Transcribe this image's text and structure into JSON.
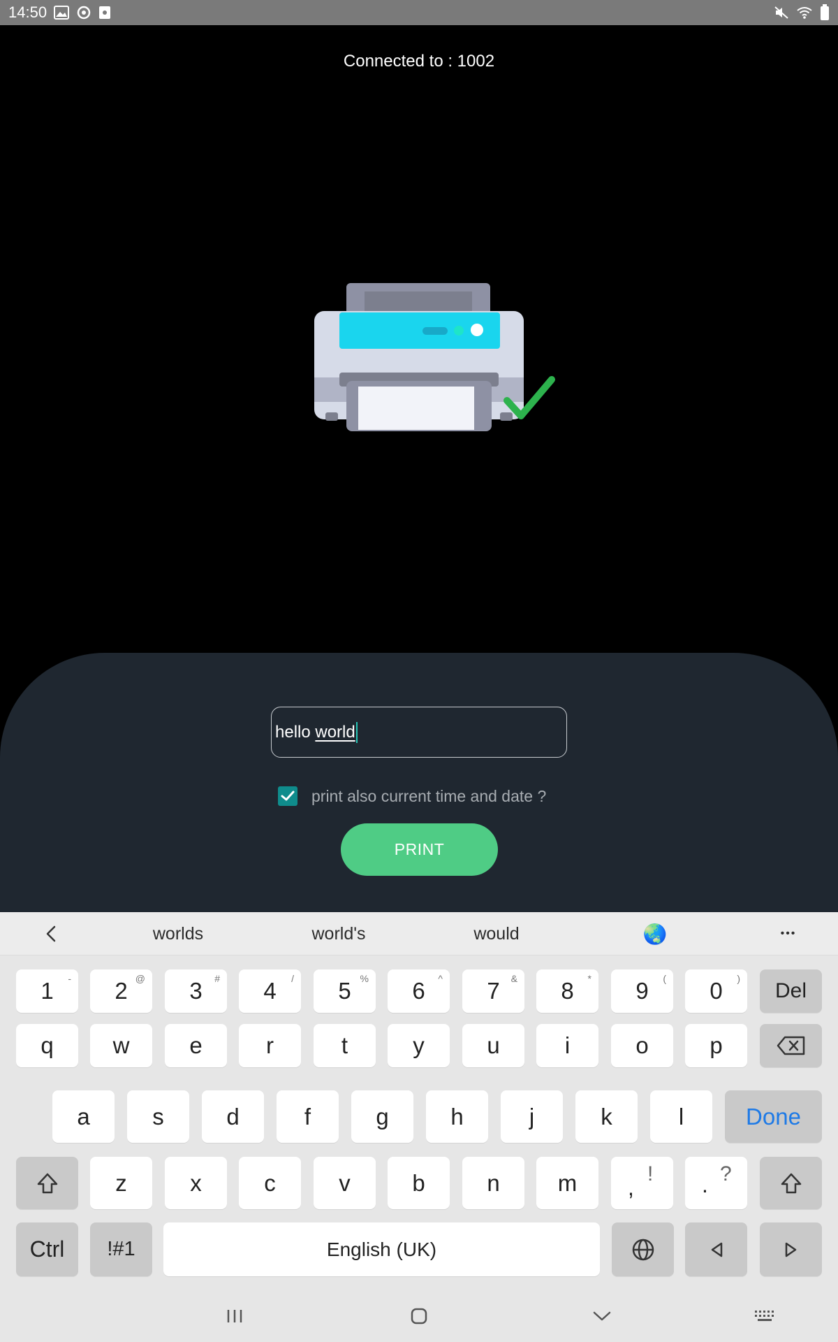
{
  "status_bar": {
    "time": "14:50",
    "left_icons": [
      "image-icon",
      "sync-icon",
      "screenshot-icon"
    ],
    "right_icons": [
      "mute-icon",
      "wifi-icon",
      "battery-icon"
    ]
  },
  "connection": {
    "label": "Connected to : 1002"
  },
  "illustration": {
    "name": "printer-success-icon",
    "colors": {
      "body": "#d6dbe8",
      "panel": "#1ad5ee",
      "top": "#7c7f8e",
      "tray": "#8e91a4",
      "paper": "#f2f3f9",
      "check": "#2db24d"
    }
  },
  "form": {
    "input_value_plain": "hello ",
    "input_value_composing": "world",
    "checkbox_checked": true,
    "checkbox_label": "print also current time and date ?",
    "print_button": "PRINT"
  },
  "colors": {
    "panel_bg": "#1f2730",
    "accent_green": "#4fcc85",
    "checkbox_teal": "#0f8c8c",
    "keyboard_done": "#1e7ae6"
  },
  "keyboard": {
    "suggestions": [
      "worlds",
      "world's",
      "would"
    ],
    "suggestion_emoji": "🌏",
    "more_label": "•••",
    "number_row": [
      {
        "key": "1",
        "hint": "-"
      },
      {
        "key": "2",
        "hint": "@"
      },
      {
        "key": "3",
        "hint": "#"
      },
      {
        "key": "4",
        "hint": "/"
      },
      {
        "key": "5",
        "hint": "%"
      },
      {
        "key": "6",
        "hint": "^"
      },
      {
        "key": "7",
        "hint": "&"
      },
      {
        "key": "8",
        "hint": "*"
      },
      {
        "key": "9",
        "hint": "("
      },
      {
        "key": "0",
        "hint": ")"
      }
    ],
    "del_label": "Del",
    "row_q": [
      "q",
      "w",
      "e",
      "r",
      "t",
      "y",
      "u",
      "i",
      "o",
      "p"
    ],
    "row_a": [
      "a",
      "s",
      "d",
      "f",
      "g",
      "h",
      "j",
      "k",
      "l"
    ],
    "done_label": "Done",
    "row_z": [
      "z",
      "x",
      "c",
      "v",
      "b",
      "n",
      "m"
    ],
    "comma_key": {
      "main": ",",
      "alt": "!"
    },
    "period_key": {
      "main": ".",
      "alt": "?"
    },
    "ctrl_label": "Ctrl",
    "symbols_label": "!#1",
    "space_label": "English (UK)"
  },
  "navigation": [
    "recent-apps-icon",
    "home-icon",
    "back-icon",
    "keyboard-switch-icon"
  ]
}
